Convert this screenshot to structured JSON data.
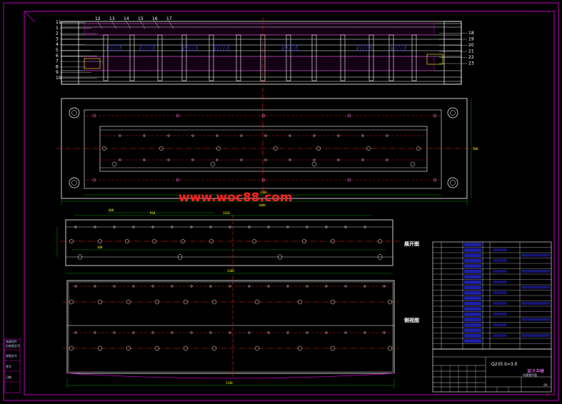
{
  "watermark": "www.woc88.com",
  "view_labels": {
    "expanded": "展开图",
    "side_view": "侧视图"
  },
  "part_numbers": {
    "top": [
      "12",
      "13",
      "14",
      "15",
      "16",
      "17"
    ],
    "left": [
      "11",
      "1",
      "2",
      "3",
      "4",
      "5",
      "6",
      "7",
      "8",
      "9",
      "10"
    ],
    "right": [
      "18",
      "19",
      "20",
      "21",
      "22",
      "23"
    ]
  },
  "dimensions": {
    "plan_length": "1800",
    "plan_inner": "1360",
    "plan_width": "560",
    "strip_top_1": "600",
    "strip_top_2": "910",
    "strip_top_3": "1420",
    "strip_pitch": "200",
    "strip_total": "1200",
    "strip_base": "1148"
  },
  "title_block": {
    "material": "Q235  δ=3.0",
    "drawing_title": "某冷冲模",
    "drawing_subtitle": "凹模零件图",
    "sheet": "-00"
  },
  "left_strip": [
    "借通用件",
    "旧底图总号",
    "底图总号",
    "签字",
    "日期"
  ],
  "colors": {
    "frame": "#c000c0",
    "geometry": "#ffffff",
    "centerline": "#ff2020",
    "dimension": "#00c000",
    "text_dim": "#ffff00",
    "title_fill": "#3030ff"
  }
}
